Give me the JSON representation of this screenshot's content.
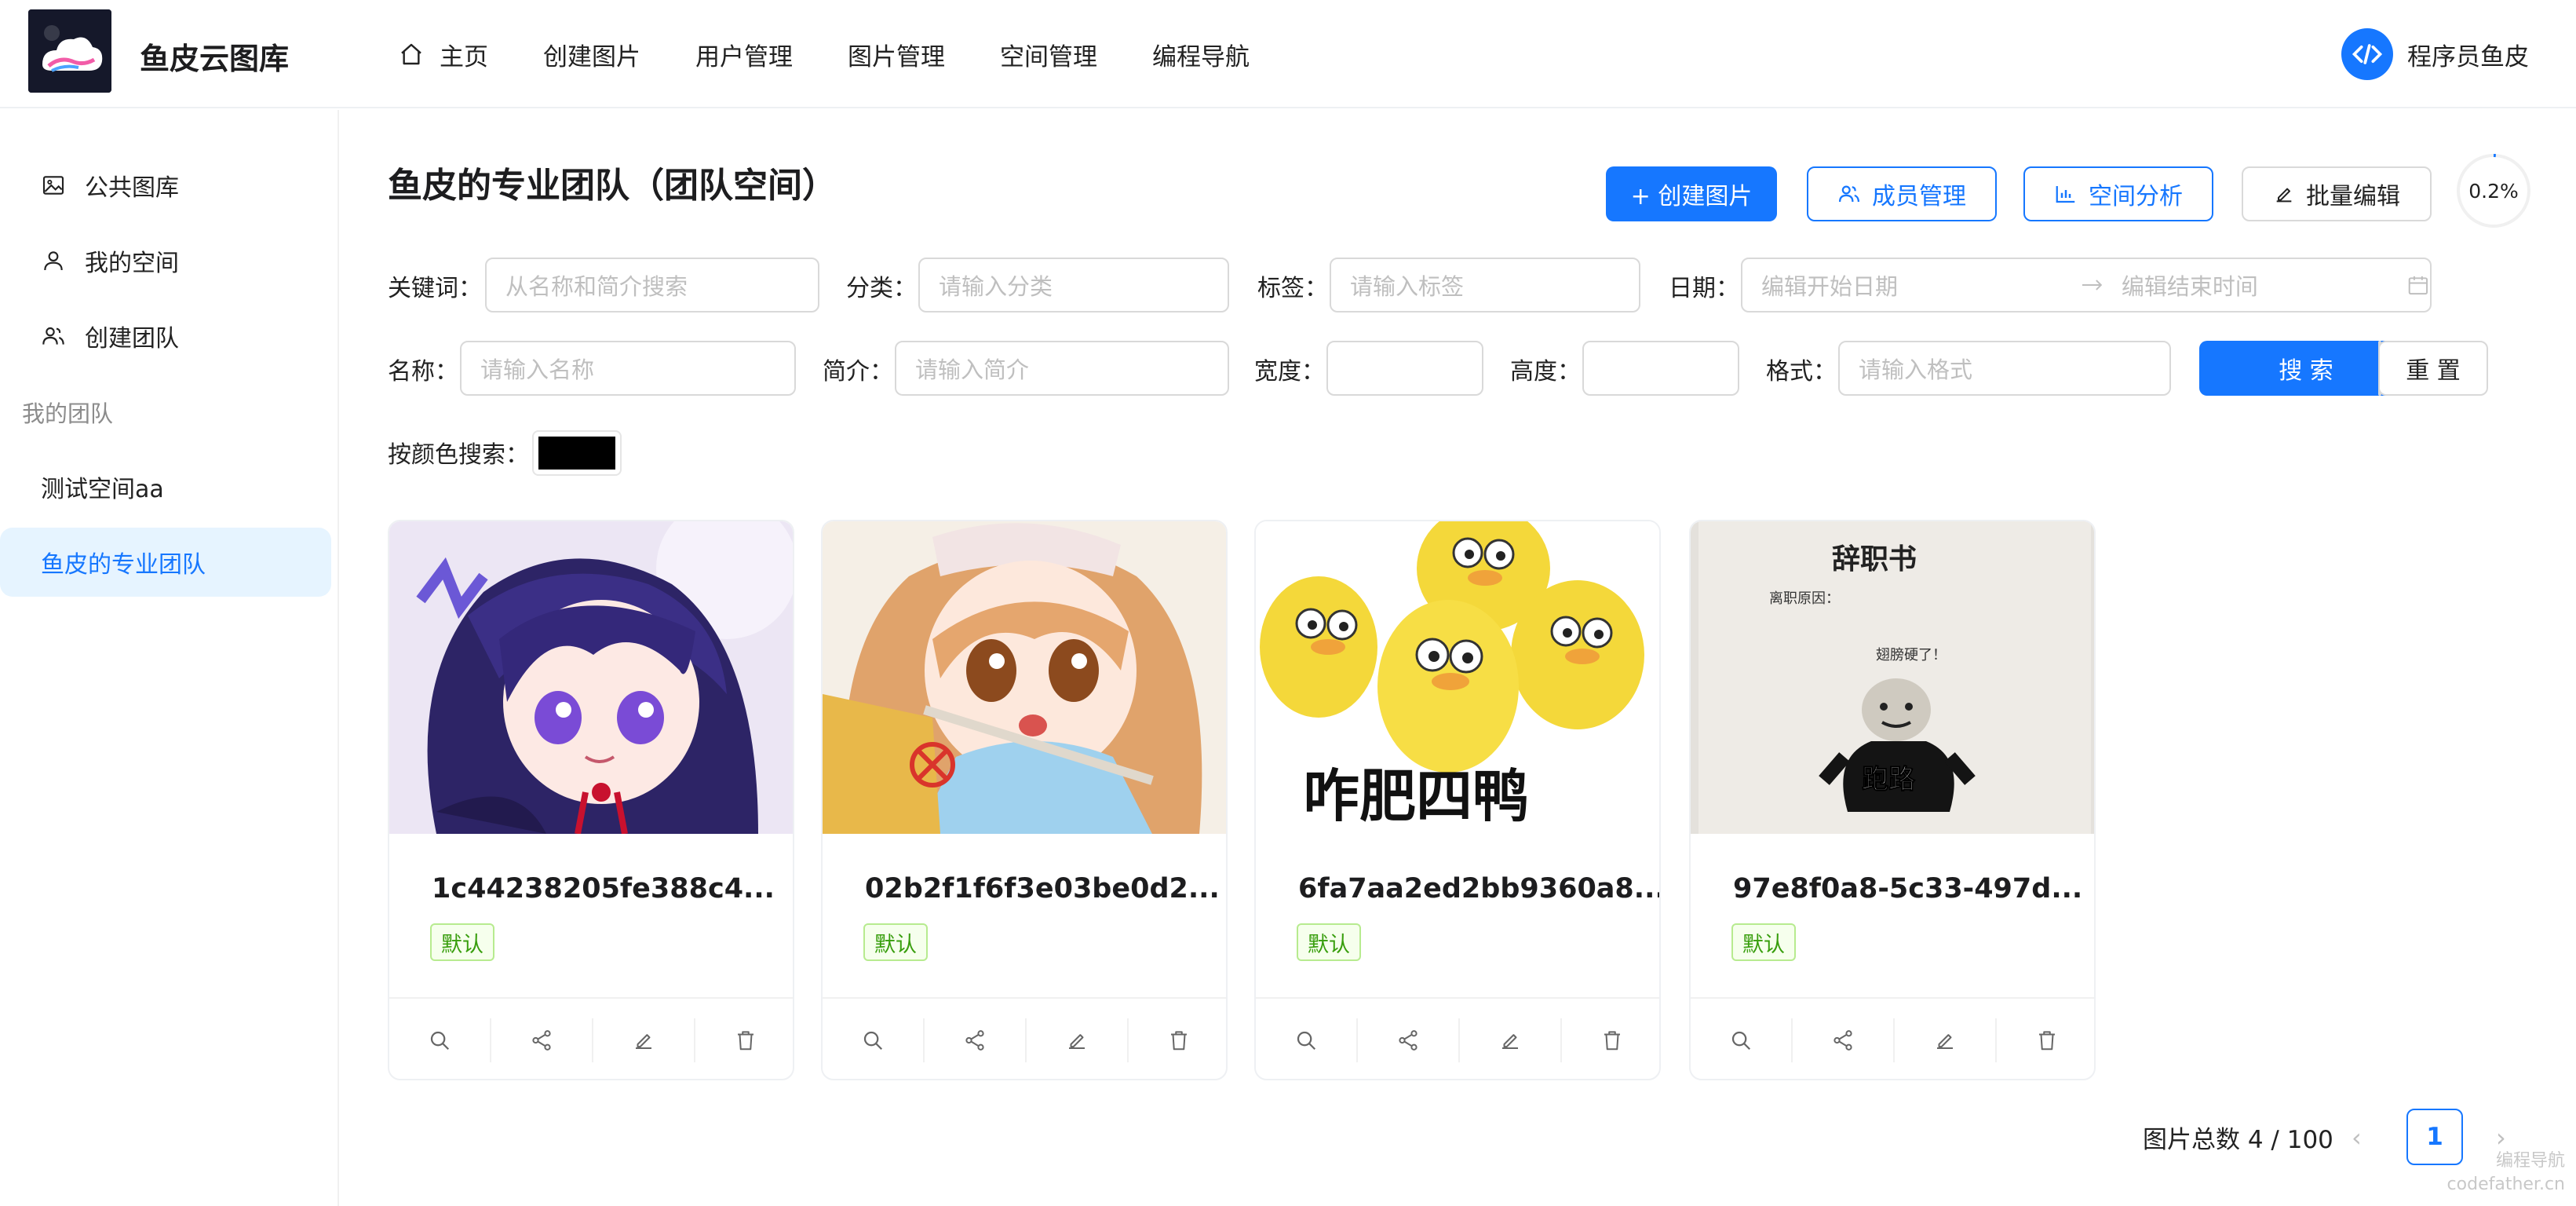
{
  "header": {
    "brand": "鱼皮云图库",
    "nav": [
      {
        "label": "主页",
        "icon": "home-icon"
      },
      {
        "label": "创建图片"
      },
      {
        "label": "用户管理"
      },
      {
        "label": "图片管理"
      },
      {
        "label": "空间管理"
      },
      {
        "label": "编程导航"
      }
    ],
    "user_name": "程序员鱼皮"
  },
  "sidebar": {
    "items": [
      {
        "label": "公共图库",
        "icon": "picture-icon"
      },
      {
        "label": "我的空间",
        "icon": "user-icon"
      },
      {
        "label": "创建团队",
        "icon": "team-icon"
      }
    ],
    "group_label": "我的团队",
    "teams": [
      {
        "label": "测试空间aa"
      },
      {
        "label": "鱼皮的专业团队",
        "active": true
      }
    ]
  },
  "main": {
    "title": "鱼皮的专业团队（团队空间）",
    "buttons": {
      "create": "+ 创建图片",
      "members": "成员管理",
      "analysis": "空间分析",
      "batch_edit": "批量编辑"
    },
    "usage_percent": "0.2%",
    "usage_fraction": 0.002,
    "filters": {
      "keyword_label": "关键词：",
      "keyword_placeholder": "从名称和简介搜索",
      "category_label": "分类：",
      "category_placeholder": "请输入分类",
      "tags_label": "标签：",
      "tags_placeholder": "请输入标签",
      "date_label": "日期：",
      "date_start_placeholder": "编辑开始日期",
      "date_end_placeholder": "编辑结束时间",
      "name_label": "名称：",
      "name_placeholder": "请输入名称",
      "intro_label": "简介：",
      "intro_placeholder": "请输入简介",
      "width_label": "宽度：",
      "height_label": "高度：",
      "format_label": "格式：",
      "format_placeholder": "请输入格式",
      "search_button": "搜 索",
      "reset_button": "重 置",
      "color_label": "按颜色搜索：",
      "color_value": "#000000"
    },
    "cards": [
      {
        "title": "1c44238205fe388c4...",
        "tag": "默认"
      },
      {
        "title": "02b2f1f6f3e03be0d2...",
        "tag": "默认"
      },
      {
        "title": "6fa7aa2ed2bb9360a8...",
        "tag": "默认",
        "image_text": "咋肥四鸭"
      },
      {
        "title": "97e8f0a8-5c33-497d...",
        "tag": "默认",
        "image_title": "辞职书",
        "image_line1": "离职原因：",
        "image_line2": "翅膀硬了！",
        "image_caption": "跑路"
      }
    ],
    "pagination": {
      "total_text": "图片总数 4 / 100",
      "current_page": "1",
      "prev": "‹",
      "next": "›"
    },
    "watermark": [
      "编程导航",
      "codefather.cn"
    ]
  },
  "colors": {
    "accent": "#1677ff",
    "active_bg": "#e6f4ff",
    "tag_green": "#389e0d"
  }
}
